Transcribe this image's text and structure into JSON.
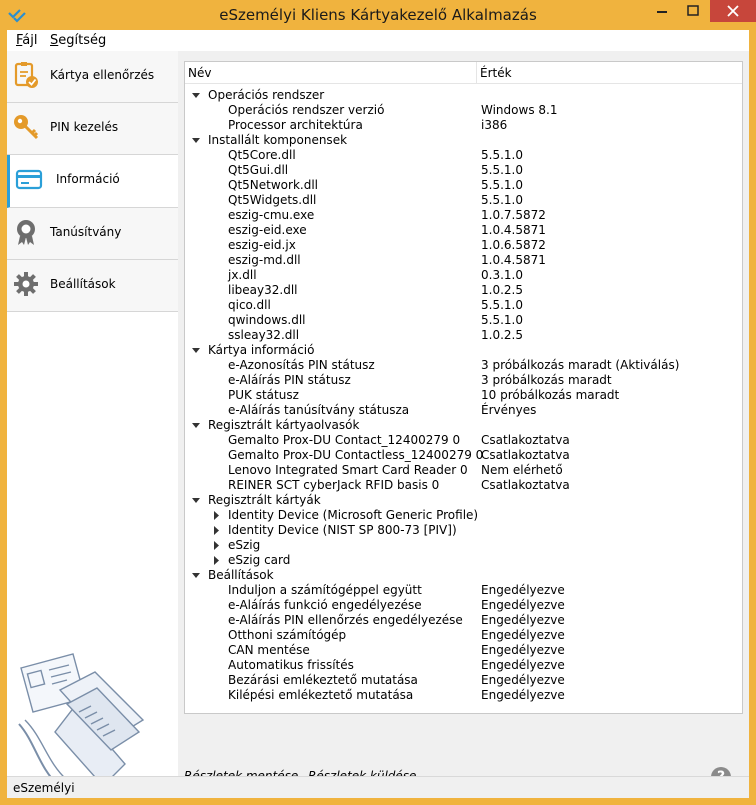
{
  "window": {
    "title": "eSzemélyi Kliens Kártyakezelő Alkalmazás"
  },
  "menu": [
    {
      "label": "Fájl"
    },
    {
      "label": "Segítség"
    }
  ],
  "sidebar": {
    "items": [
      {
        "label": "Kártya ellenőrzés",
        "icon": "card-check-icon"
      },
      {
        "label": "PIN kezelés",
        "icon": "key-icon"
      },
      {
        "label": "Információ",
        "icon": "card-info-icon",
        "active": true
      },
      {
        "label": "Tanúsítvány",
        "icon": "certificate-icon"
      },
      {
        "label": "Beállítások",
        "icon": "gear-icon"
      }
    ]
  },
  "tree": {
    "columns": {
      "name": "Név",
      "value": "Érték"
    },
    "rows": [
      {
        "level": 0,
        "expander": "expanded",
        "name": "Operációs rendszer",
        "value": ""
      },
      {
        "level": 1,
        "expander": "none",
        "name": "Operációs rendszer verzió",
        "value": "Windows 8.1"
      },
      {
        "level": 1,
        "expander": "none",
        "name": "Processor architektúra",
        "value": "i386"
      },
      {
        "level": 0,
        "expander": "expanded",
        "name": "Installált komponensek",
        "value": ""
      },
      {
        "level": 1,
        "expander": "none",
        "name": "Qt5Core.dll",
        "value": "5.5.1.0"
      },
      {
        "level": 1,
        "expander": "none",
        "name": "Qt5Gui.dll",
        "value": "5.5.1.0"
      },
      {
        "level": 1,
        "expander": "none",
        "name": "Qt5Network.dll",
        "value": "5.5.1.0"
      },
      {
        "level": 1,
        "expander": "none",
        "name": "Qt5Widgets.dll",
        "value": "5.5.1.0"
      },
      {
        "level": 1,
        "expander": "none",
        "name": "eszig-cmu.exe",
        "value": "1.0.7.5872"
      },
      {
        "level": 1,
        "expander": "none",
        "name": "eszig-eid.exe",
        "value": "1.0.4.5871"
      },
      {
        "level": 1,
        "expander": "none",
        "name": "eszig-eid.jx",
        "value": "1.0.6.5872"
      },
      {
        "level": 1,
        "expander": "none",
        "name": "eszig-md.dll",
        "value": "1.0.4.5871"
      },
      {
        "level": 1,
        "expander": "none",
        "name": "jx.dll",
        "value": "0.3.1.0"
      },
      {
        "level": 1,
        "expander": "none",
        "name": "libeay32.dll",
        "value": "1.0.2.5"
      },
      {
        "level": 1,
        "expander": "none",
        "name": "qico.dll",
        "value": "5.5.1.0"
      },
      {
        "level": 1,
        "expander": "none",
        "name": "qwindows.dll",
        "value": "5.5.1.0"
      },
      {
        "level": 1,
        "expander": "none",
        "name": "ssleay32.dll",
        "value": "1.0.2.5"
      },
      {
        "level": 0,
        "expander": "expanded",
        "name": "Kártya információ",
        "value": ""
      },
      {
        "level": 1,
        "expander": "none",
        "name": "e-Azonosítás PIN státusz",
        "value": "3 próbálkozás maradt (Aktiválás)"
      },
      {
        "level": 1,
        "expander": "none",
        "name": "e-Aláírás PIN státusz",
        "value": "3 próbálkozás maradt"
      },
      {
        "level": 1,
        "expander": "none",
        "name": "PUK státusz",
        "value": "10 próbálkozás maradt"
      },
      {
        "level": 1,
        "expander": "none",
        "name": "e-Aláírás tanúsítvány státusza",
        "value": "Érvényes"
      },
      {
        "level": 0,
        "expander": "expanded",
        "name": "Regisztrált kártyaolvasók",
        "value": ""
      },
      {
        "level": 1,
        "expander": "none",
        "name": "Gemalto Prox-DU Contact_12400279 0",
        "value": "Csatlakoztatva"
      },
      {
        "level": 1,
        "expander": "none",
        "name": "Gemalto Prox-DU Contactless_12400279 0",
        "value": "Csatlakoztatva"
      },
      {
        "level": 1,
        "expander": "none",
        "name": "Lenovo Integrated Smart Card Reader 0",
        "value": "Nem elérhető"
      },
      {
        "level": 1,
        "expander": "none",
        "name": "REINER SCT cyberJack RFID basis 0",
        "value": "Csatlakoztatva"
      },
      {
        "level": 0,
        "expander": "expanded",
        "name": "Regisztrált kártyák",
        "value": ""
      },
      {
        "level": 1,
        "expander": "collapsed",
        "name": "Identity Device (Microsoft Generic Profile)",
        "value": ""
      },
      {
        "level": 1,
        "expander": "collapsed",
        "name": "Identity Device (NIST SP 800-73 [PIV])",
        "value": ""
      },
      {
        "level": 1,
        "expander": "collapsed",
        "name": "eSzig",
        "value": ""
      },
      {
        "level": 1,
        "expander": "collapsed",
        "name": "eSzig card",
        "value": ""
      },
      {
        "level": 0,
        "expander": "expanded",
        "name": "Beállítások",
        "value": ""
      },
      {
        "level": 1,
        "expander": "none",
        "name": "Induljon a számítógéppel együtt",
        "value": "Engedélyezve"
      },
      {
        "level": 1,
        "expander": "none",
        "name": "e-Aláírás funkció engedélyezése",
        "value": "Engedélyezve"
      },
      {
        "level": 1,
        "expander": "none",
        "name": "e-Aláírás PIN ellenőrzés engedélyezése",
        "value": "Engedélyezve"
      },
      {
        "level": 1,
        "expander": "none",
        "name": "Otthoni számítógép",
        "value": "Engedélyezve"
      },
      {
        "level": 1,
        "expander": "none",
        "name": "CAN mentése",
        "value": "Engedélyezve"
      },
      {
        "level": 1,
        "expander": "none",
        "name": "Automatikus frissítés",
        "value": "Engedélyezve"
      },
      {
        "level": 1,
        "expander": "none",
        "name": "Bezárási emlékeztető mutatása",
        "value": "Engedélyezve"
      },
      {
        "level": 1,
        "expander": "none",
        "name": "Kilépési emlékeztető mutatása",
        "value": "Engedélyezve"
      }
    ]
  },
  "links": {
    "save": "Részletek mentése",
    "send": "Részletek küldése"
  },
  "help": {
    "label": "?"
  },
  "status": {
    "text": "eSzemélyi"
  },
  "colors": {
    "titlebar": "#f0b33e",
    "accent": "#2a9fd8",
    "close": "#c7463b"
  }
}
